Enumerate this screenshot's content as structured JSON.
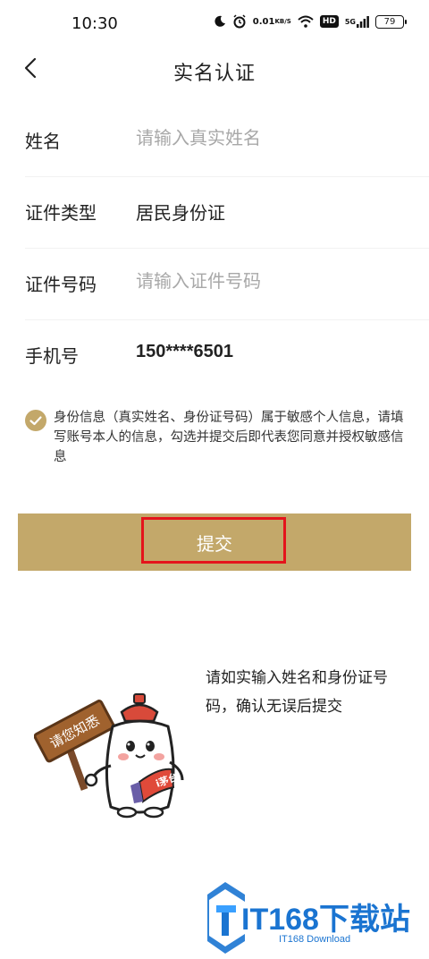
{
  "status_bar": {
    "time": "10:30",
    "net_speed_value": "0.01",
    "net_speed_unit": "KB/S",
    "hd_label": "HD",
    "signal_label": "5G",
    "battery": "79"
  },
  "nav": {
    "title": "实名认证"
  },
  "form": {
    "name_label": "姓名",
    "name_placeholder": "请输入真实姓名",
    "id_type_label": "证件类型",
    "id_type_value": "居民身份证",
    "id_number_label": "证件号码",
    "id_number_placeholder": "请输入证件号码",
    "phone_label": "手机号",
    "phone_value": "150****6501"
  },
  "consent": {
    "checked": true,
    "text": "身份信息（真实姓名、身份证号码）属于敏感个人信息，请填写账号本人的信息，勾选并提交后即代表您同意并授权敏感信息"
  },
  "submit": {
    "label": "提交"
  },
  "hint": {
    "text": "请如实输入姓名和身份证号码，确认无误后提交"
  },
  "mascot": {
    "sign_text": "请您知悉",
    "bottle_text": "i茅台"
  },
  "watermark": {
    "main": "IT168下载站",
    "sub": "IT168 Download"
  },
  "colors": {
    "accent": "#c3a86a",
    "highlight": "#e4141b",
    "watermark": "#1a74d1"
  }
}
